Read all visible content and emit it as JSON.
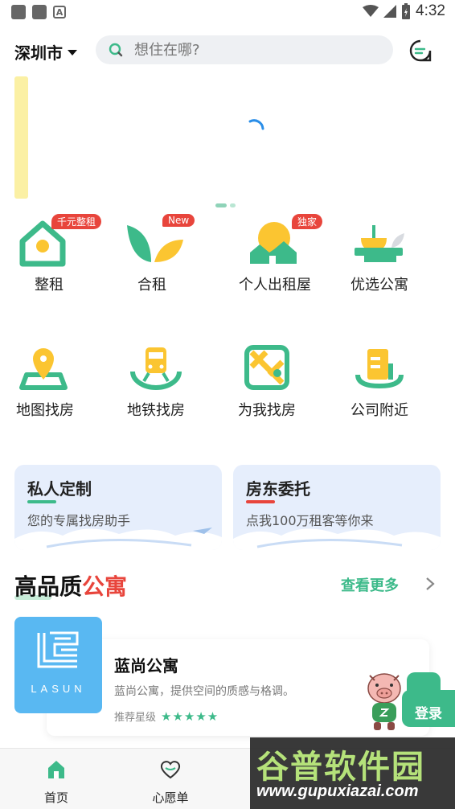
{
  "status_bar": {
    "time": "4:32",
    "notif_letter": "A"
  },
  "header": {
    "city": "深圳市",
    "search_placeholder": "想住在哪?"
  },
  "categories_row1": [
    {
      "label": "整租",
      "badge": "千元整租",
      "icon": "home-icon"
    },
    {
      "label": "合租",
      "badge": "New",
      "icon": "leaf-icon"
    },
    {
      "label": "个人出租屋",
      "badge": "独家",
      "icon": "sunrise-house-icon"
    },
    {
      "label": "优选公寓",
      "badge": "",
      "icon": "bowl-icon"
    }
  ],
  "categories_row2": [
    {
      "label": "地图找房",
      "icon": "map-pin-icon"
    },
    {
      "label": "地铁找房",
      "icon": "subway-icon"
    },
    {
      "label": "为我找房",
      "icon": "route-map-icon"
    },
    {
      "label": "公司附近",
      "icon": "building-icon"
    }
  ],
  "promos": [
    {
      "title": "私人定制",
      "subtitle": "您的专属找房助手",
      "accent": "#3dba8a"
    },
    {
      "title": "房东委托",
      "subtitle": "点我100万租客等你来",
      "accent": "#e8453c"
    }
  ],
  "section": {
    "title_main": "高品质",
    "title_highlight": "公寓",
    "see_more": "查看更多"
  },
  "apartment": {
    "logo_text": "LASUN",
    "name": "蓝尚公寓",
    "description": "蓝尚公寓，提供空间的质感与格调。",
    "rating_label": "推荐星级",
    "stars": 5
  },
  "login": {
    "label": "登录"
  },
  "bottom_nav": [
    {
      "label": "首页",
      "icon": "home-nav-icon"
    },
    {
      "label": "心愿单",
      "icon": "heart-icon"
    }
  ],
  "watermark": {
    "big": "谷普软件园",
    "url": "www.gupuxiazai.com"
  },
  "colors": {
    "accent": "#3dba8a",
    "red": "#e8453c",
    "yellow": "#fbc531"
  }
}
